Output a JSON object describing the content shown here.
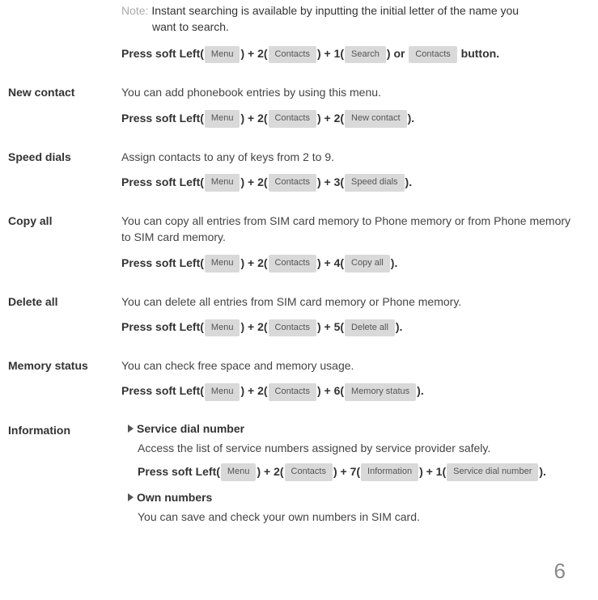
{
  "top": {
    "note_label": "Note:",
    "note_text_1": "Instant searching is available by inputting the initial letter of the name you",
    "note_text_2": "want to search.",
    "press_prefix": "Press soft Left(",
    "menu": "Menu",
    "seg2": ") + 2(",
    "contacts": "Contacts",
    "seg3": ") + 1(",
    "search": "Search",
    "seg_or": ") or",
    "contacts2": "Contacts",
    "seg_end": "button."
  },
  "sections": {
    "new_contact": {
      "label": "New contact",
      "desc": "You can add phonebook entries by using this menu.",
      "press_prefix": "Press soft Left(",
      "menu": "Menu",
      "s2": ") + 2(",
      "contacts": "Contacts",
      "s3": ") + 2(",
      "btn": "New contact",
      "end": ")."
    },
    "speed_dials": {
      "label": "Speed dials",
      "desc": "Assign contacts to any of keys from 2 to 9.",
      "press_prefix": "Press soft Left(",
      "menu": "Menu",
      "s2": ") + 2(",
      "contacts": "Contacts",
      "s3": ") + 3(",
      "btn": "Speed dials",
      "end": ")."
    },
    "copy_all": {
      "label": "Copy all",
      "desc": "You can copy all entries from SIM card memory to Phone memory or from Phone memory to SIM card memory.",
      "press_prefix": "Press soft Left(",
      "menu": "Menu",
      "s2": ") + 2(",
      "contacts": "Contacts",
      "s3": ") + 4(",
      "btn": "Copy all",
      "end": ")."
    },
    "delete_all": {
      "label": "Delete all",
      "desc": "You can delete all entries from SIM card memory or Phone memory.",
      "press_prefix": "Press soft Left(",
      "menu": "Menu",
      "s2": ") + 2(",
      "contacts": "Contacts",
      "s3": ") + 5(",
      "btn": "Delete all",
      "end": ")."
    },
    "memory_status": {
      "label": "Memory status",
      "desc": "You can check free space and memory usage.",
      "press_prefix": "Press soft Left(",
      "menu": "Menu",
      "s2": ") + 2(",
      "contacts": "Contacts",
      "s3": ") + 6(",
      "btn": "Memory status",
      "end": ")."
    },
    "information": {
      "label": "Information",
      "sub1": {
        "heading": "Service dial number",
        "desc": "Access the list of service numbers assigned by service provider safely.",
        "press_prefix": "Press soft Left(",
        "menu": "Menu",
        "s2": ") + 2(",
        "contacts": "Contacts",
        "s3": ") + 7(",
        "info": "Information",
        "s4": ") + 1(",
        "btn": "Service dial number",
        "end": ")."
      },
      "sub2": {
        "heading": "Own numbers",
        "desc": "You can save and check your own numbers in SIM card."
      }
    }
  },
  "page_number": "6"
}
